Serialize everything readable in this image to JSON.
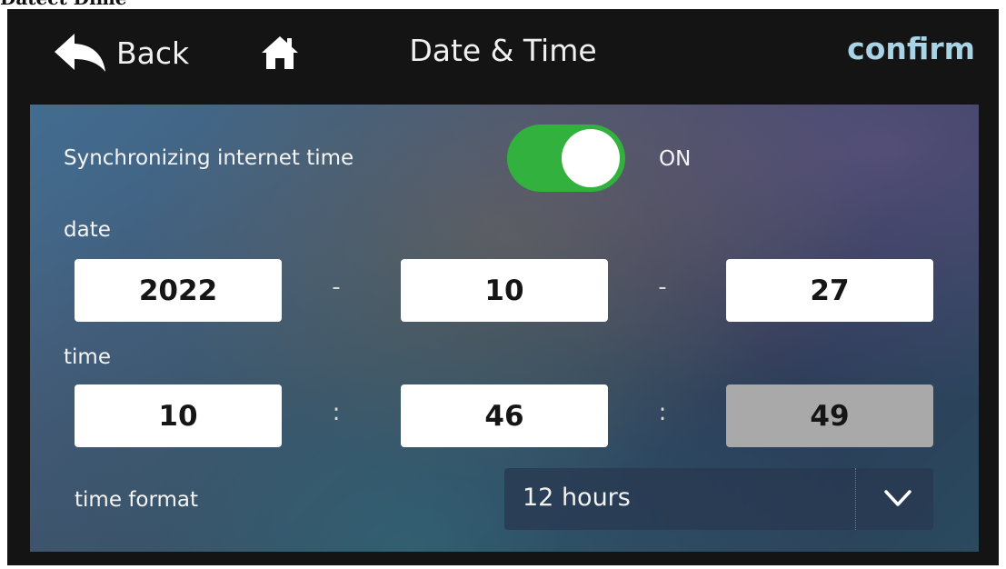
{
  "caption": "Datect Dime",
  "header": {
    "back_label": "Back",
    "title": "Date & Time",
    "confirm_label": "confirm"
  },
  "sync": {
    "label": "Synchronizing internet time",
    "state_text": "ON",
    "enabled": true,
    "toggle_color": "#33b13f"
  },
  "date": {
    "label": "date",
    "year": "2022",
    "month": "10",
    "day": "27",
    "separator": "-"
  },
  "time": {
    "label": "time",
    "hour": "10",
    "minute": "46",
    "second": "49",
    "separator": ":"
  },
  "time_format": {
    "label": "time format",
    "selected": "12 hours"
  },
  "colors": {
    "confirm": "#a8d4e6",
    "header_bg": "#141414",
    "disabled_field": "#a9a9a9"
  }
}
